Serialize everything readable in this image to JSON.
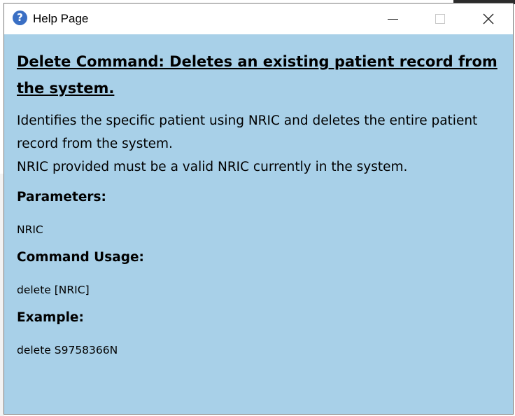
{
  "window": {
    "title": "Help Page",
    "icon": "question-icon",
    "icon_glyph": "?",
    "background_color": "#a8d0e8"
  },
  "help": {
    "heading": "Delete Command: Deletes an existing patient record from the system.",
    "description_line1": "Identifies the specific patient using NRIC and deletes the entire patient record from the system.",
    "description_line2": "NRIC provided must be a valid NRIC currently in the system.",
    "parameters_title": "Parameters:",
    "parameters_value": "NRIC",
    "usage_title": "Command Usage:",
    "usage_value": "delete [NRIC]",
    "example_title": "Example:",
    "example_value": "delete S9758366N"
  }
}
